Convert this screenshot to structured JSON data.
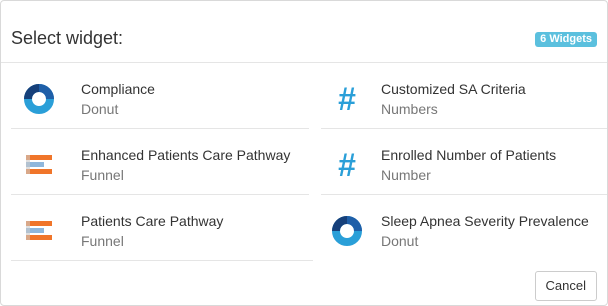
{
  "dialog": {
    "title": "Select widget:",
    "badge": "6 Widgets"
  },
  "widgets": [
    {
      "name": "Compliance",
      "type": "Donut",
      "icon": "donut-icon"
    },
    {
      "name": "Customized SA Criteria",
      "type": "Numbers",
      "icon": "hash-icon"
    },
    {
      "name": "Enhanced Patients Care Pathway",
      "type": "Funnel",
      "icon": "funnel-icon"
    },
    {
      "name": "Enrolled Number of Patients",
      "type": "Number",
      "icon": "hash-icon"
    },
    {
      "name": "Patients Care Pathway",
      "type": "Funnel",
      "icon": "funnel-icon"
    },
    {
      "name": "Sleep Apnea Severity Prevalence",
      "type": "Donut",
      "icon": "donut-icon"
    }
  ],
  "footer": {
    "cancel_label": "Cancel"
  },
  "colors": {
    "accent": "#2a9fd8",
    "donut_dark": "#1f5fa8",
    "badge": "#5bc0de",
    "funnel_orange": "#f0752a",
    "funnel_blue": "#8fb7dc",
    "funnel_gray": "#c9c9c9"
  }
}
